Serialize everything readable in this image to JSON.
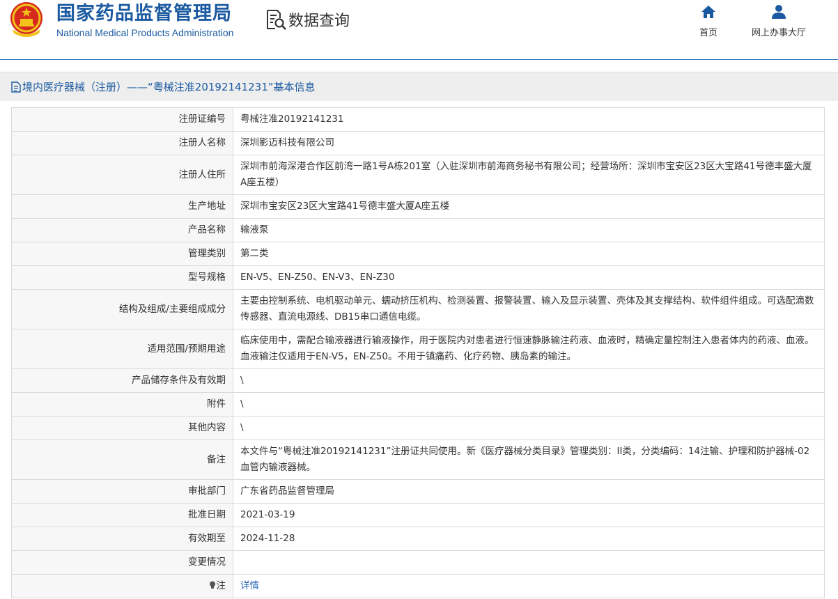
{
  "header": {
    "org_name_cn": "国家药品监督管理局",
    "org_name_en": "National Medical Products Administration",
    "query_title": "数据查询",
    "nav": {
      "home": "首页",
      "service_hall": "网上办事大厅"
    }
  },
  "page_title": "境内医疗器械（注册）——“粤械注准20192141231”基本信息",
  "colors": {
    "brand_blue": "#1b5aa0",
    "link_blue": "#2a6bbd",
    "emblem_red": "#d62a1f",
    "emblem_gold": "#f2c318"
  },
  "records": [
    {
      "label": "注册证编号",
      "value": "粤械注准20192141231"
    },
    {
      "label": "注册人名称",
      "value": "深圳影迈科技有限公司"
    },
    {
      "label": "注册人住所",
      "value": "深圳市前海深港合作区前湾一路1号A栋201室（入驻深圳市前海商务秘书有限公司；经营场所：深圳市宝安区23区大宝路41号德丰盛大厦A座五楼）"
    },
    {
      "label": "生产地址",
      "value": "深圳市宝安区23区大宝路41号德丰盛大厦A座五楼"
    },
    {
      "label": "产品名称",
      "value": "输液泵"
    },
    {
      "label": "管理类别",
      "value": "第二类"
    },
    {
      "label": "型号规格",
      "value": "EN-V5、EN-Z50、EN-V3、EN-Z30"
    },
    {
      "label": "结构及组成/主要组成成分",
      "value": "主要由控制系统、电机驱动单元、蠕动挤压机构、检测装置、报警装置、输入及显示装置、壳体及其支撑结构、软件组件组成。可选配滴数传感器、直流电源线、DB15串口通信电缆。"
    },
    {
      "label": "适用范围/预期用途",
      "value": "临床使用中，需配合输液器进行输液操作，用于医院内对患者进行恒速静脉输注药液、血液时，精确定量控制注入患者体内的药液、血液。血液输注仅适用于EN-V5，EN-Z50。不用于镇痛药、化疗药物、胰岛素的输注。"
    },
    {
      "label": "产品储存条件及有效期",
      "value": "\\"
    },
    {
      "label": "附件",
      "value": "\\"
    },
    {
      "label": "其他内容",
      "value": "\\"
    },
    {
      "label": "备注",
      "value": "本文件与“粤械注准20192141231”注册证共同使用。新《医疗器械分类目录》管理类别：II类，分类编码：14注输、护理和防护器械-02血管内输液器械。"
    },
    {
      "label": "审批部门",
      "value": "广东省药品监督管理局"
    },
    {
      "label": "批准日期",
      "value": "2021-03-19"
    },
    {
      "label": "有效期至",
      "value": "2024-11-28"
    },
    {
      "label": "变更情况",
      "value": ""
    }
  ],
  "note_row": {
    "label": "注",
    "icon": "bulb-icon",
    "link_text": "详情"
  }
}
